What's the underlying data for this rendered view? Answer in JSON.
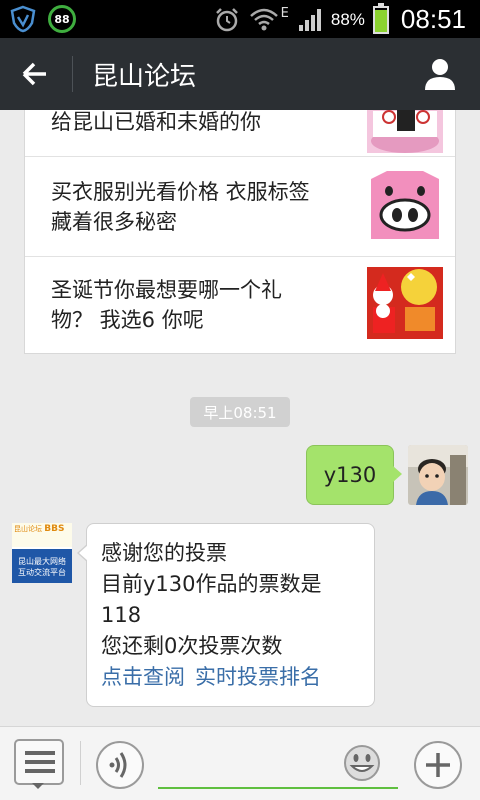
{
  "status_bar": {
    "indicator_badge": "88",
    "network_type": "E",
    "battery_percent": "88%",
    "battery_level": 0.88,
    "time": "08:51"
  },
  "header": {
    "title": "昆山论坛",
    "back_icon": "arrow-left-icon",
    "profile_icon": "person-icon"
  },
  "news_card": {
    "items": [
      {
        "title_line1": "给昆山已婚和未婚的你",
        "title_line2": ""
      },
      {
        "title_line1": "买衣服别光看价格 衣服标签",
        "title_line2": "藏着很多秘密"
      },
      {
        "title_line1": "圣诞节你最想要哪一个礼",
        "title_line2": "物？ 我选6 你呢"
      }
    ]
  },
  "timestamp": "早上08:51",
  "messages": {
    "outgoing_text": "y130",
    "incoming_lines": [
      "感谢您的投票",
      "目前y130作品的票数是",
      "118",
      "您还剩0次投票次数"
    ],
    "incoming_links": [
      "点击查阅",
      "实时投票排名"
    ],
    "bot_avatar_text_top": "昆山论坛",
    "bot_avatar_text_bbs": "BBS",
    "bot_avatar_text_line1": "昆山最大网络",
    "bot_avatar_text_line2": "互动交流平台"
  },
  "input_bar": {
    "placeholder": "",
    "menu_icon": "list-menu-icon",
    "voice_icon": "voice-icon",
    "emoji_icon": "smiley-icon",
    "plus_icon": "plus-icon"
  },
  "colors": {
    "title_bar": "#2b2f33",
    "bubble_out": "#a4e36b",
    "link": "#3a6ea8",
    "input_underline": "#5fbf3f"
  }
}
